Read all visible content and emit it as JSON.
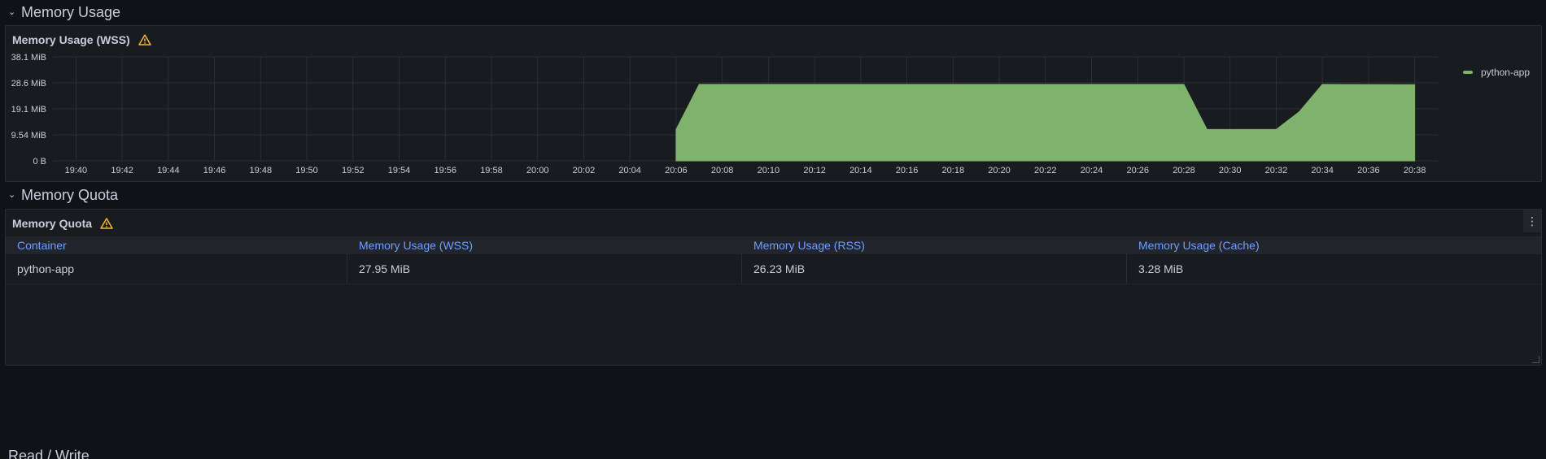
{
  "rows": {
    "memory_usage": "Memory Usage",
    "memory_quota": "Memory Quota",
    "next_partial": "Read / Write"
  },
  "panel_wss": {
    "title": "Memory Usage (WSS)",
    "legend": "python-app"
  },
  "chart_data": {
    "type": "area",
    "title": "Memory Usage (WSS)",
    "series": [
      {
        "name": "python-app",
        "color": "#7eb26d",
        "points": [
          [
            "20:06",
            11.5
          ],
          [
            "20:07",
            28.0
          ],
          [
            "20:28",
            28.0
          ],
          [
            "20:29",
            11.5
          ],
          [
            "20:32",
            11.5
          ],
          [
            "20:33",
            18.0
          ],
          [
            "20:34",
            28.0
          ],
          [
            "20:38",
            27.9
          ]
        ]
      }
    ],
    "x_ticks": [
      "19:40",
      "19:42",
      "19:44",
      "19:46",
      "19:48",
      "19:50",
      "19:52",
      "19:54",
      "19:56",
      "19:58",
      "20:00",
      "20:02",
      "20:04",
      "20:06",
      "20:08",
      "20:10",
      "20:12",
      "20:14",
      "20:16",
      "20:18",
      "20:20",
      "20:22",
      "20:24",
      "20:26",
      "20:28",
      "20:30",
      "20:32",
      "20:34",
      "20:36",
      "20:38"
    ],
    "y_ticks": [
      "0 B",
      "9.54 MiB",
      "19.1 MiB",
      "28.6 MiB",
      "38.1 MiB"
    ],
    "y_tick_values": [
      0,
      9.54,
      19.1,
      28.6,
      38.1
    ],
    "ylim": [
      0,
      38.1
    ],
    "xlim": [
      "19:39",
      "20:39"
    ],
    "grid": true,
    "legend_position": "right"
  },
  "panel_quota": {
    "title": "Memory Quota",
    "columns": [
      "Container",
      "Memory Usage (WSS)",
      "Memory Usage (RSS)",
      "Memory Usage (Cache)"
    ],
    "rows": [
      [
        "python-app",
        "27.95 MiB",
        "26.23 MiB",
        "3.28 MiB"
      ]
    ],
    "menu_icon": "⋮"
  },
  "colors": {
    "background": "#111217",
    "panel": "#181b1f",
    "series": "#7eb26d",
    "header_link": "#6e9fff",
    "warning": "#f5b73d"
  }
}
